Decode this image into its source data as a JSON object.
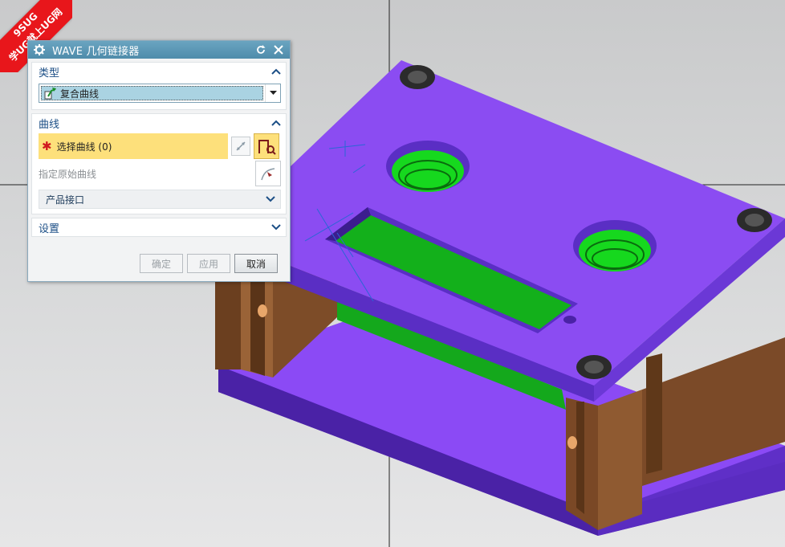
{
  "watermark": {
    "line1": "9SUG",
    "line2": "学UG就上UG网"
  },
  "dialog": {
    "title": "WAVE 几何链接器",
    "icons": {
      "settings": "gear-icon",
      "reset": "reset-icon",
      "close": "close-icon"
    },
    "sections": {
      "type": {
        "header": "类型",
        "selected": "复合曲线"
      },
      "curve": {
        "header": "曲线",
        "required_marker": "✱",
        "select_label": "选择曲线 (0)",
        "original_curve_label": "指定原始曲线",
        "product_interface_label": "产品接口"
      },
      "settings": {
        "header": "设置"
      }
    },
    "buttons": {
      "ok": "确定",
      "apply": "应用",
      "cancel": "取消"
    }
  },
  "colors": {
    "accent_title": "#4f8cab",
    "section_header": "#1c4f86",
    "selection_highlight": "#fde07b",
    "model_plate": "#8c4cf2",
    "model_pocket": "#12b81a",
    "model_block": "#7a4a2a"
  }
}
